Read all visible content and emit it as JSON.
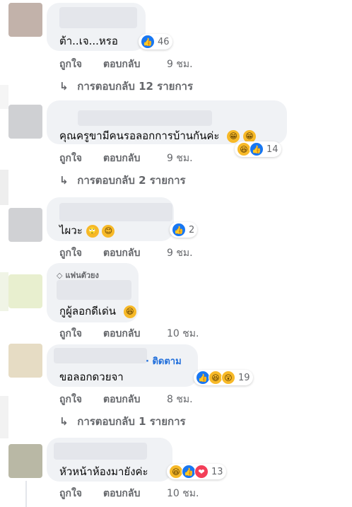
{
  "comments": [
    {
      "text": "ต้า..เจ...หรอ",
      "reaction_count": "46",
      "like": "ถูกใจ",
      "reply": "ตอบกลับ",
      "time": "9 ชม.",
      "replies_label": "การตอบกลับ 12 รายการ"
    },
    {
      "text": "คุณครูขามีคนรอลอกการบ้านกันค่ะ",
      "reaction_count": "14",
      "like": "ถูกใจ",
      "reply": "ตอบกลับ",
      "time": "9 ชม.",
      "replies_label": "การตอบกลับ 2 รายการ"
    },
    {
      "text": "ไผวะ",
      "reaction_count": "2",
      "like": "ถูกใจ",
      "reply": "ตอบกลับ",
      "time": "9 ชม."
    },
    {
      "badge": "แฟนตัวยง",
      "text": "กูผู้ลอกดีเด่น",
      "like": "ถูกใจ",
      "reply": "ตอบกลับ",
      "time": "10 ชม."
    },
    {
      "follow": "· ติดตาม",
      "text": "ขอลอกดวยจา",
      "reaction_count": "19",
      "like": "ถูกใจ",
      "reply": "ตอบกลับ",
      "time": "8 ชม.",
      "replies_label": "การตอบกลับ 1 รายการ"
    },
    {
      "text": "หัวหน้าห้องมายังค่ะ",
      "reaction_count": "13",
      "like": "ถูกใจ",
      "reply": "ตอบกลับ",
      "time": "10 ชม."
    }
  ],
  "icons": {
    "reply_arrow": "↳",
    "like": "👍",
    "haha": "😆",
    "love": "❤",
    "wow": "😲",
    "grin": "😁",
    "eye_roll": "🙄",
    "smile": "😊",
    "diamond": "◇"
  },
  "colors": {
    "link": "#216fdb",
    "like": "#1877f2",
    "bubble": "#f0f2f5",
    "muted": "#65676b"
  }
}
